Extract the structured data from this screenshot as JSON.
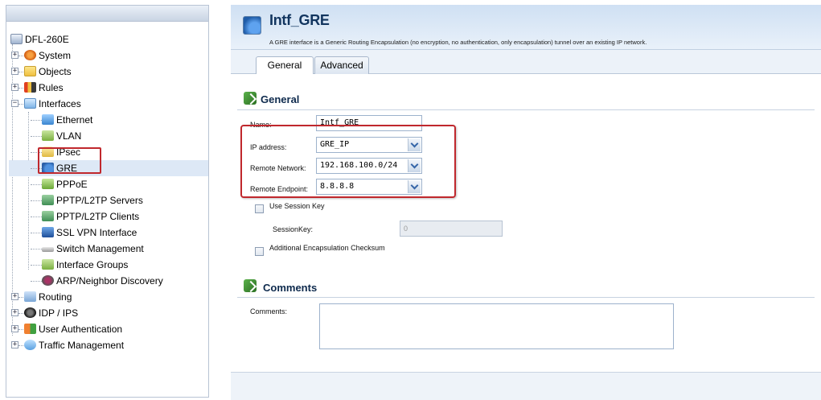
{
  "tree": {
    "root": "DFL-260E",
    "items": [
      {
        "label": "System"
      },
      {
        "label": "Objects"
      },
      {
        "label": "Rules"
      },
      {
        "label": "Interfaces"
      },
      {
        "label": "Ethernet"
      },
      {
        "label": "VLAN"
      },
      {
        "label": "IPsec"
      },
      {
        "label": "GRE"
      },
      {
        "label": "PPPoE"
      },
      {
        "label": "PPTP/L2TP Servers"
      },
      {
        "label": "PPTP/L2TP Clients"
      },
      {
        "label": "SSL VPN Interface"
      },
      {
        "label": "Switch Management"
      },
      {
        "label": "Interface Groups"
      },
      {
        "label": "ARP/Neighbor Discovery"
      },
      {
        "label": "Routing"
      },
      {
        "label": "IDP / IPS"
      },
      {
        "label": "User Authentication"
      },
      {
        "label": "Traffic Management"
      }
    ],
    "expand_plus": "+",
    "expand_minus": "−"
  },
  "header": {
    "title": "Intf_GRE",
    "description": "A GRE interface is a Generic Routing Encapsulation (no encryption, no authentication, only encapsulation) tunnel over an existing IP network."
  },
  "tabs": [
    {
      "label": "General"
    },
    {
      "label": "Advanced"
    }
  ],
  "general": {
    "title": "General",
    "name_label": "Name:",
    "name_value": "Intf_GRE",
    "ip_label": "IP address:",
    "ip_value": "GRE_IP",
    "remote_network_label": "Remote Network:",
    "remote_network_value": "192.168.100.0/24",
    "remote_endpoint_label": "Remote Endpoint:",
    "remote_endpoint_value": "8.8.8.8",
    "use_session_key_label": "Use Session Key",
    "session_key_label": "SessionKey:",
    "session_key_value": "0",
    "checksum_label": "Additional Encapsulation Checksum"
  },
  "comments": {
    "title": "Comments",
    "label": "Comments:"
  },
  "colors": {
    "highlight": "#c0282d",
    "header_title": "#12355f"
  }
}
